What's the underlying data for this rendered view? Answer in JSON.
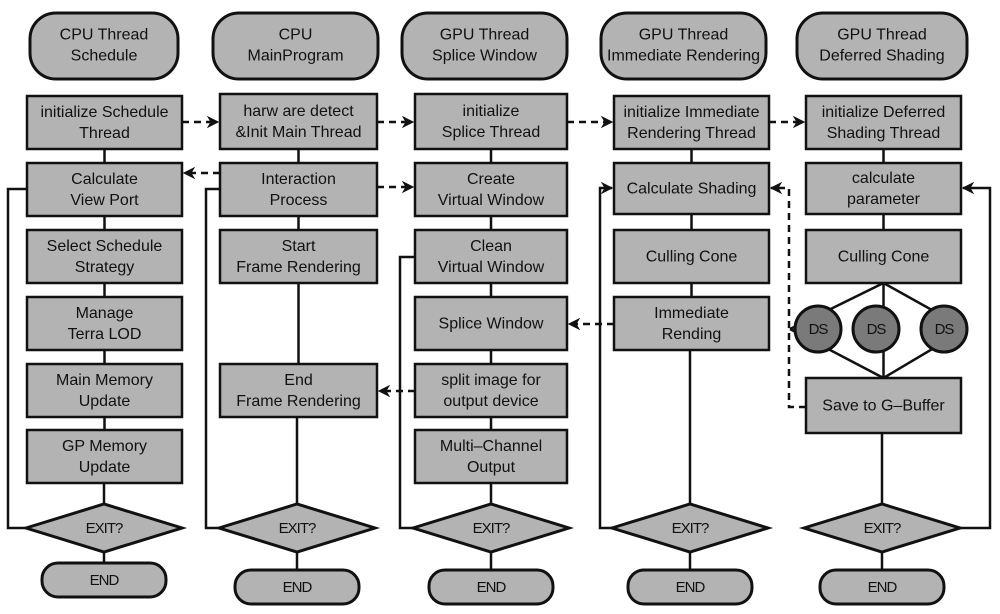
{
  "colors": {
    "box_fill": "#b3b3b3",
    "ds_fill": "#7a7a7a",
    "stroke": "#111111",
    "background": "#ffffff"
  },
  "columns": [
    {
      "id": "cpu-schedule",
      "header": [
        "CPU Thread",
        "Schedule"
      ],
      "steps": [
        [
          "initialize Schedule",
          "Thread"
        ],
        [
          "Calculate",
          "View Port"
        ],
        [
          "Select  Schedule",
          "Strategy"
        ],
        [
          "Manage",
          "Terra LOD"
        ],
        [
          "Main  Memory",
          "Update"
        ],
        [
          "GP  Memory",
          "Update"
        ]
      ],
      "decision": "EXIT?",
      "end": "END"
    },
    {
      "id": "cpu-main",
      "header": [
        "CPU",
        "MainProgram"
      ],
      "steps": [
        [
          "harw are  detect",
          "&Init  Main  Thread"
        ],
        [
          "Interaction",
          "Process"
        ],
        [
          "Start",
          "Frame  Rendering"
        ],
        [
          "End",
          "Frame  Rendering"
        ]
      ],
      "decision": "EXIT?",
      "end": "END"
    },
    {
      "id": "gpu-splice",
      "header": [
        "GPU Thread",
        "Splice Window"
      ],
      "steps": [
        [
          "initialize",
          "Splice  Thread"
        ],
        [
          "Create",
          "Virtual  Window"
        ],
        [
          "Clean",
          "Virtual  Window"
        ],
        [
          "Splice  Window"
        ],
        [
          "split  image  for",
          "output  device"
        ],
        [
          "Multi–Channel",
          "Output"
        ]
      ],
      "decision": "EXIT?",
      "end": "END"
    },
    {
      "id": "gpu-immediate",
      "header": [
        "GPU Thread",
        "Immediate Rendering"
      ],
      "steps": [
        [
          "initialize Immediate",
          "Rendering Thread"
        ],
        [
          "Calculate  Shading"
        ],
        [
          "Culling  Cone"
        ],
        [
          "Immediate",
          "Rending"
        ]
      ],
      "decision": "EXIT?",
      "end": "END"
    },
    {
      "id": "gpu-deferred",
      "header": [
        "GPU Thread",
        "Deferred  Shading"
      ],
      "steps": [
        [
          "initialize Deferred",
          "Shading  Thread"
        ],
        [
          "calculate",
          "parameter"
        ],
        [
          "Culling  Cone"
        ],
        [
          "Save  to  G–Buffer"
        ]
      ],
      "parallel_nodes": [
        "DS",
        "DS",
        "DS"
      ],
      "decision": "EXIT?",
      "end": "END"
    }
  ],
  "connections": [
    {
      "from": "initialize Schedule Thread",
      "to": "hardware detect & Init Main Thread",
      "style": "dashed"
    },
    {
      "from": "hardware detect & Init Main Thread",
      "to": "initialize Splice Thread",
      "style": "dashed"
    },
    {
      "from": "initialize Splice Thread",
      "to": "initialize Immediate Rendering Thread",
      "style": "dashed"
    },
    {
      "from": "initialize Immediate Rendering Thread",
      "to": "initialize Deferred Shading Thread",
      "style": "dashed"
    },
    {
      "from": "Interaction Process",
      "to": "Calculate View Port",
      "style": "dashed"
    },
    {
      "from": "Interaction Process",
      "to": "Create Virtual Window",
      "style": "dashed"
    },
    {
      "from": "Immediate Rending",
      "to": "Splice Window",
      "style": "dashed"
    },
    {
      "from": "split image for output device",
      "to": "End Frame Rendering",
      "style": "dashed"
    },
    {
      "from": "Save to G-Buffer",
      "to": "Calculate Shading",
      "style": "dashed"
    }
  ]
}
